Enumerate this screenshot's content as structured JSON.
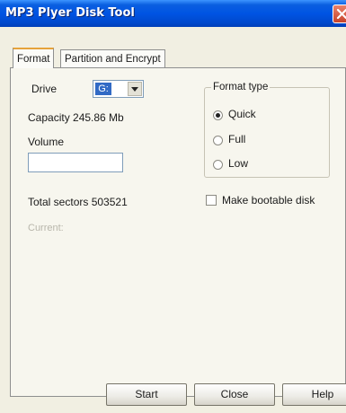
{
  "window": {
    "title": "MP3 Plyer Disk Tool"
  },
  "tabs": [
    {
      "label": "Format",
      "active": true
    },
    {
      "label": "Partition and Encrypt",
      "active": false
    }
  ],
  "format": {
    "drive_label": "Drive",
    "drive_value": "G:",
    "capacity_text": "Capacity 245.86 Mb",
    "volume_label": "Volume",
    "volume_value": "",
    "total_sectors_text": "Total sectors 503521",
    "current_label": "Current:",
    "format_type": {
      "title": "Format type",
      "options": [
        "Quick",
        "Full",
        "Low"
      ],
      "selected": "Quick"
    },
    "make_bootable_label": "Make bootable disk",
    "make_bootable_checked": false
  },
  "buttons": {
    "start": "Start",
    "close": "Close",
    "help": "Help"
  },
  "colors": {
    "titlebar": "#0054e3",
    "selection": "#316ac5",
    "tab_highlight": "#e6a33b"
  }
}
